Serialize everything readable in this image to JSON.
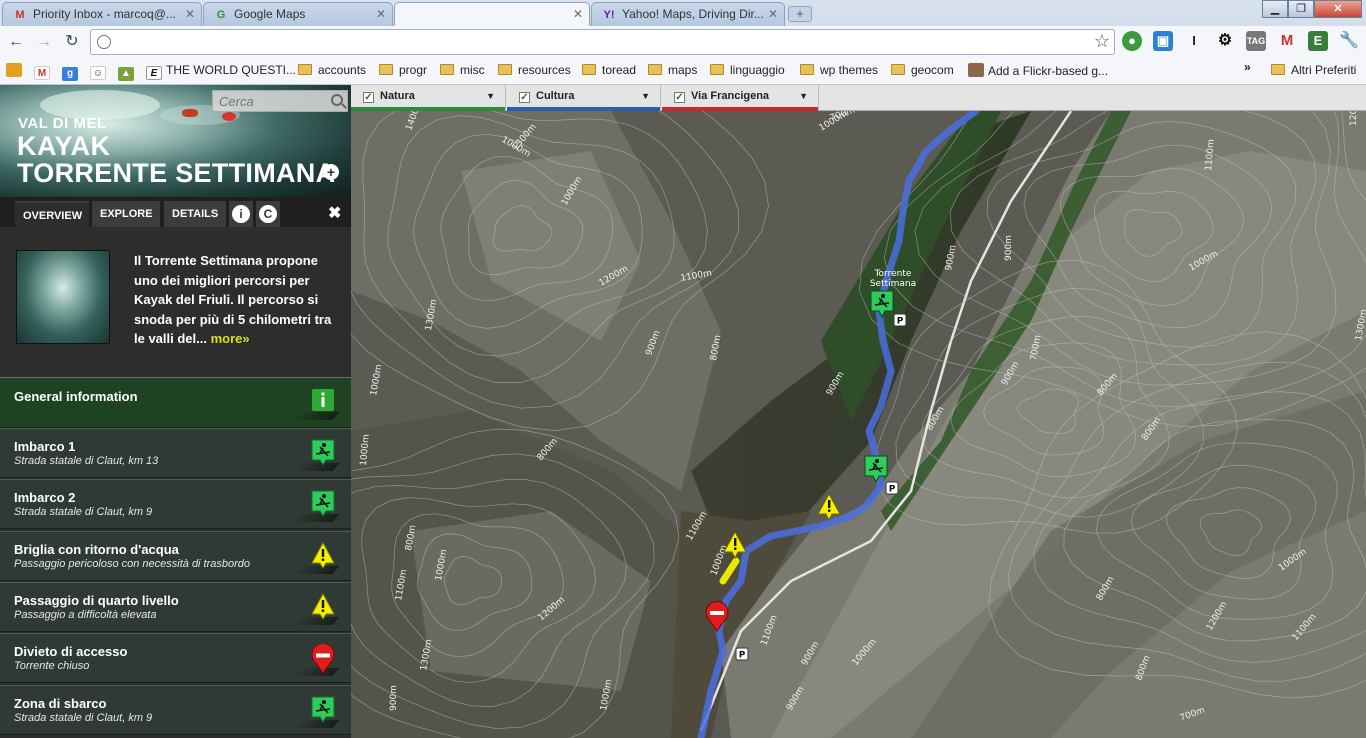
{
  "browser": {
    "tabs": [
      {
        "label": "Priority Inbox - marcoq@...",
        "favicon": "gmail-icon"
      },
      {
        "label": "Google Maps",
        "favicon": "google-maps-icon"
      },
      {
        "label": "",
        "favicon": ""
      },
      {
        "label": "Yahoo! Maps, Driving Dir...",
        "favicon": "yahoo-icon"
      }
    ],
    "address": "",
    "bookmarks": [
      {
        "label": "THE WORLD QUESTI...",
        "type": "site"
      },
      {
        "label": "accounts",
        "type": "folder"
      },
      {
        "label": "progr",
        "type": "folder"
      },
      {
        "label": "misc",
        "type": "folder"
      },
      {
        "label": "resources",
        "type": "folder"
      },
      {
        "label": "toread",
        "type": "folder"
      },
      {
        "label": "maps",
        "type": "folder"
      },
      {
        "label": "linguaggio",
        "type": "folder"
      },
      {
        "label": "wp themes",
        "type": "folder"
      },
      {
        "label": "geocom",
        "type": "folder"
      },
      {
        "label": "Add a Flickr-based g...",
        "type": "site"
      }
    ],
    "overflow": "»",
    "other_bookmarks": "Altri Preferiti"
  },
  "sidebar": {
    "search_placeholder": "Cerca",
    "subtitle": "VAL DI MEL",
    "title_line1": "KAYAK",
    "title_line2": "TORRENTE SETTIMANA",
    "tabs": [
      {
        "label": "OVERVIEW",
        "active": true
      },
      {
        "label": "EXPLORE",
        "active": false
      },
      {
        "label": "DETAILS",
        "active": false
      }
    ],
    "info_icon_label": "i",
    "c_icon_label": "C",
    "close_label": "✖",
    "description": "Il Torrente Settimana propone uno dei migliori percorsi per Kayak del Friuli. Il percorso si snoda per più di 5 chilometri tra le valli del...",
    "more_label": "more»",
    "items": [
      {
        "title": "General information",
        "subtitle": "",
        "icon": "info-icon"
      },
      {
        "title": "Imbarco 1",
        "subtitle": "Strada statale di Claut, km 13",
        "icon": "kayak-icon"
      },
      {
        "title": "Imbarco 2",
        "subtitle": "Strada statale di Claut, km 9",
        "icon": "kayak-icon"
      },
      {
        "title": "Briglia con ritorno d'acqua",
        "subtitle": "Passaggio pericoloso con necessità di trasbordo",
        "icon": "warning-icon"
      },
      {
        "title": "Passaggio di quarto livello",
        "subtitle": "Passaggio a difficoltà elevata",
        "icon": "warning-icon"
      },
      {
        "title": "Divieto di accesso",
        "subtitle": "Torrente chiuso",
        "icon": "no-entry-icon"
      },
      {
        "title": "Zona di sbarco",
        "subtitle": "Strada statale di Claut, km 9",
        "icon": "kayak-icon"
      }
    ]
  },
  "filters": [
    {
      "label": "Natura",
      "checked": true,
      "color": "#2f8a3a"
    },
    {
      "label": "Cultura",
      "checked": true,
      "color": "#2a5fb0"
    },
    {
      "label": "Via Francigena",
      "checked": true,
      "color": "#c62a2a"
    }
  ],
  "map": {
    "place_label_line1": "Torrente",
    "place_label_line2": "Settimana",
    "parking_label": "P",
    "contours": [
      "1400m",
      "1300m",
      "1000m",
      "1200m",
      "1100m",
      "1000m",
      "1300m",
      "900m",
      "800m",
      "900m",
      "1000m",
      "700m",
      "800m",
      "800m",
      "1000m",
      "1100m",
      "1200m",
      "1300m",
      "900m",
      "1000m",
      "1100m",
      "900m",
      "800m",
      "900m",
      "800m",
      "700m",
      "800m",
      "1000m",
      "1100m",
      "1200m",
      "1300m",
      "1000m",
      "900m",
      "800m",
      "1200m",
      "1000m",
      "1100m",
      "800m",
      "700m",
      "900m",
      "900m",
      "1100m",
      "1000m",
      "1000m",
      "1000m"
    ],
    "colors": {
      "route": "#4a6fe0",
      "kayak": "#2ecc5a",
      "warning": "#f4f000",
      "noentry": "#e21b1b"
    }
  }
}
